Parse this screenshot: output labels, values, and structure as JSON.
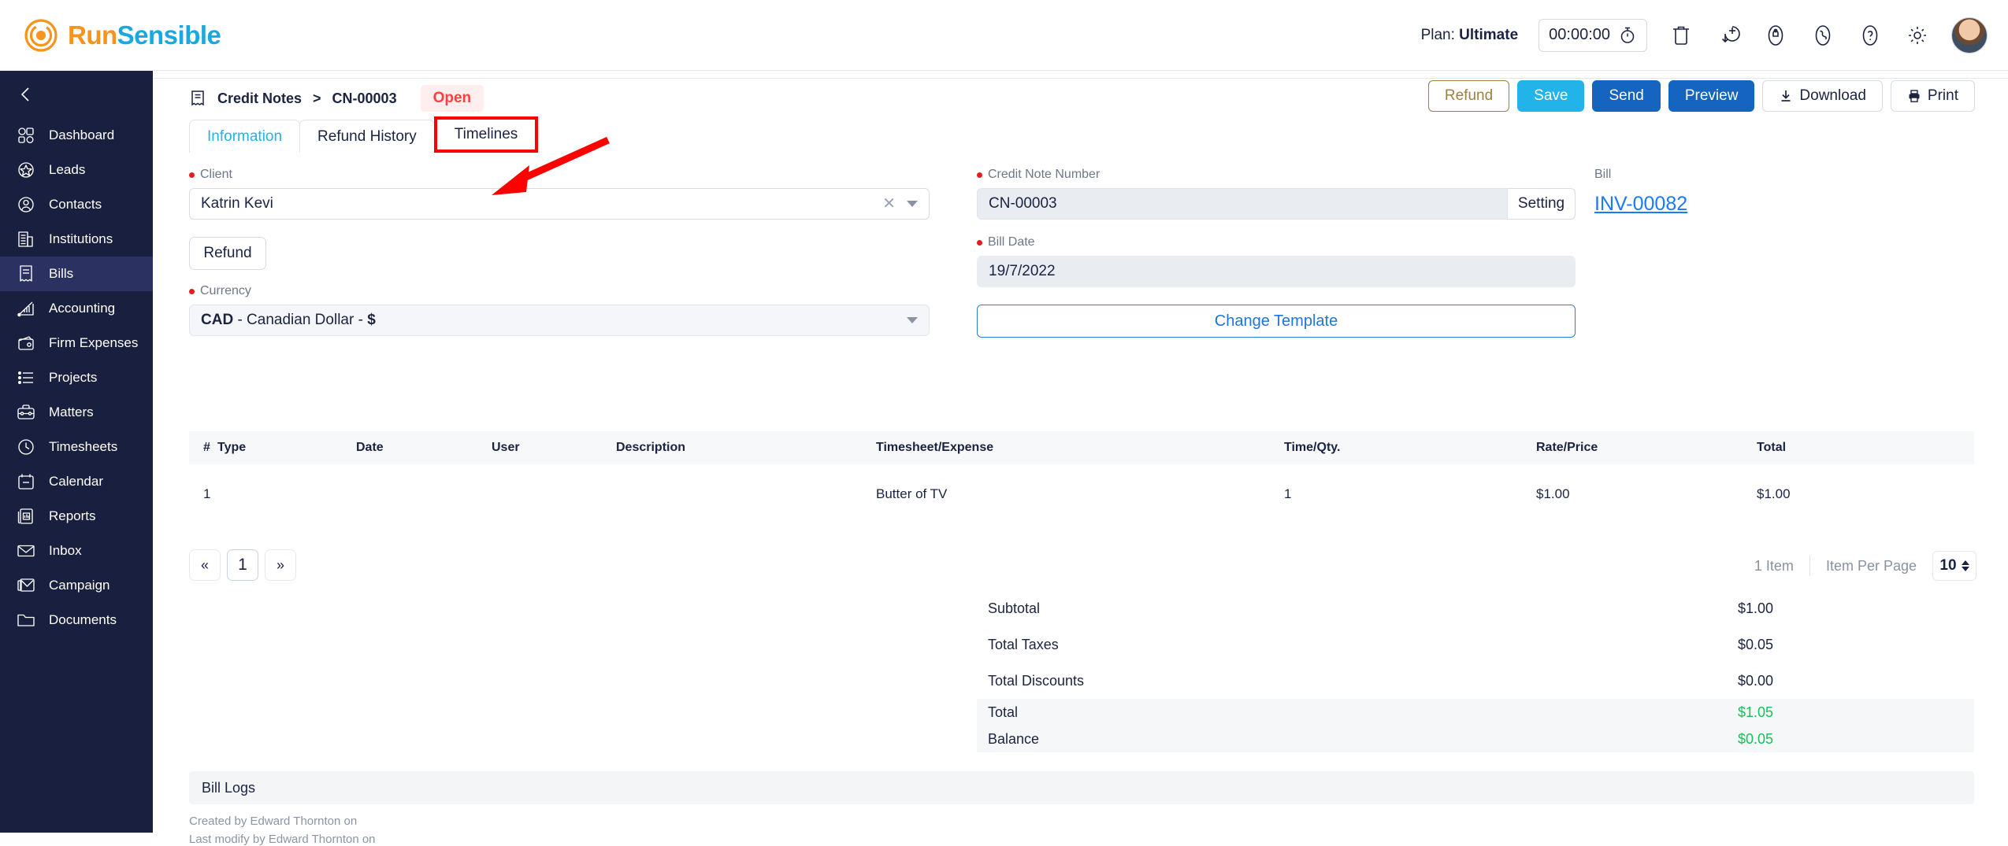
{
  "brand": {
    "run": "Run",
    "sensible": "Sensible",
    "accent_orange": "#f7941e",
    "accent_blue": "#19a8e0"
  },
  "topbar": {
    "plan_prefix": "Plan: ",
    "plan_value": "Ultimate",
    "timer": "00:00:00",
    "icons": [
      "stopwatch-icon",
      "trash-icon",
      "add-circle-icon",
      "notification-icon",
      "phone-icon",
      "help-icon",
      "gear-icon",
      "avatar"
    ]
  },
  "sidebar": {
    "collapse": "collapse-sidebar",
    "items": [
      {
        "label": "Dashboard",
        "icon": "dashboard-icon",
        "active": false
      },
      {
        "label": "Leads",
        "icon": "leads-star-icon",
        "active": false
      },
      {
        "label": "Contacts",
        "icon": "contacts-user-icon",
        "active": false
      },
      {
        "label": "Institutions",
        "icon": "institutions-building-icon",
        "active": false
      },
      {
        "label": "Bills",
        "icon": "bills-receipt-icon",
        "active": true
      },
      {
        "label": "Accounting",
        "icon": "accounting-chart-icon",
        "active": false
      },
      {
        "label": "Firm Expenses",
        "icon": "wallet-icon",
        "active": false
      },
      {
        "label": "Projects",
        "icon": "projects-list-icon",
        "active": false
      },
      {
        "label": "Matters",
        "icon": "matters-briefcase-icon",
        "active": false
      },
      {
        "label": "Timesheets",
        "icon": "clock-icon",
        "active": false
      },
      {
        "label": "Calendar",
        "icon": "calendar-icon",
        "active": false
      },
      {
        "label": "Reports",
        "icon": "reports-icon",
        "active": false
      },
      {
        "label": "Inbox",
        "icon": "envelope-icon",
        "active": false
      },
      {
        "label": "Campaign",
        "icon": "campaign-icon",
        "active": false
      },
      {
        "label": "Documents",
        "icon": "folder-icon",
        "active": false
      }
    ]
  },
  "breadcrumb": {
    "icon": "credit-note-icon",
    "root": "Credit Notes",
    "separator": ">",
    "current": "CN-00003",
    "status": "Open",
    "status_color": "#ff4040",
    "status_bg": "#ffeeee"
  },
  "actions": {
    "refund": "Refund",
    "save": "Save",
    "send": "Send",
    "preview": "Preview",
    "download": "Download",
    "print": "Print"
  },
  "tabs": [
    {
      "label": "Information",
      "active": true,
      "highlighted": false
    },
    {
      "label": "Refund History",
      "active": false,
      "highlighted": false
    },
    {
      "label": "Timelines",
      "active": false,
      "highlighted": true
    }
  ],
  "form": {
    "client_label": "Client",
    "client_value": "Katrin Kevi",
    "refund_button": "Refund",
    "currency_label": "Currency",
    "currency_code": "CAD",
    "currency_rest": " - Canadian Dollar - ",
    "currency_symbol": "$",
    "cn_number_label": "Credit Note Number",
    "cn_number_value": "CN-00003",
    "setting_button": "Setting",
    "bill_date_label": "Bill Date",
    "bill_date_value": "19/7/2022",
    "change_template": "Change Template",
    "bill_label": "Bill",
    "bill_link": "INV-00082"
  },
  "table": {
    "columns": [
      "#",
      "Type",
      "Date",
      "User",
      "Description",
      "Timesheet/Expense",
      "Time/Qty.",
      "Rate/Price",
      "Total"
    ],
    "rows": [
      {
        "num": "1",
        "type": "",
        "date": "",
        "user": "",
        "description": "",
        "timesheet": "Butter of TV",
        "qty": "1",
        "rate": "$1.00",
        "total": "$1.00"
      }
    ]
  },
  "pagination": {
    "prev": "«",
    "pages": [
      "1"
    ],
    "next": "»",
    "item_count": "1 Item",
    "per_page_label": "Item Per Page",
    "per_page_value": "10"
  },
  "totals": [
    {
      "label": "Subtotal",
      "value": "$1.00",
      "emphasis": false
    },
    {
      "label": "Total Taxes",
      "value": "$0.05",
      "emphasis": false
    },
    {
      "label": "Total Discounts",
      "value": "$0.00",
      "emphasis": false
    },
    {
      "label": "Total",
      "value": "$1.05",
      "emphasis": true
    },
    {
      "label": "Balance",
      "value": "$0.05",
      "emphasis": true
    }
  ],
  "logs": {
    "title": "Bill Logs",
    "created": "Created by Edward Thornton on",
    "modified": "Last modify by Edward Thornton on"
  }
}
